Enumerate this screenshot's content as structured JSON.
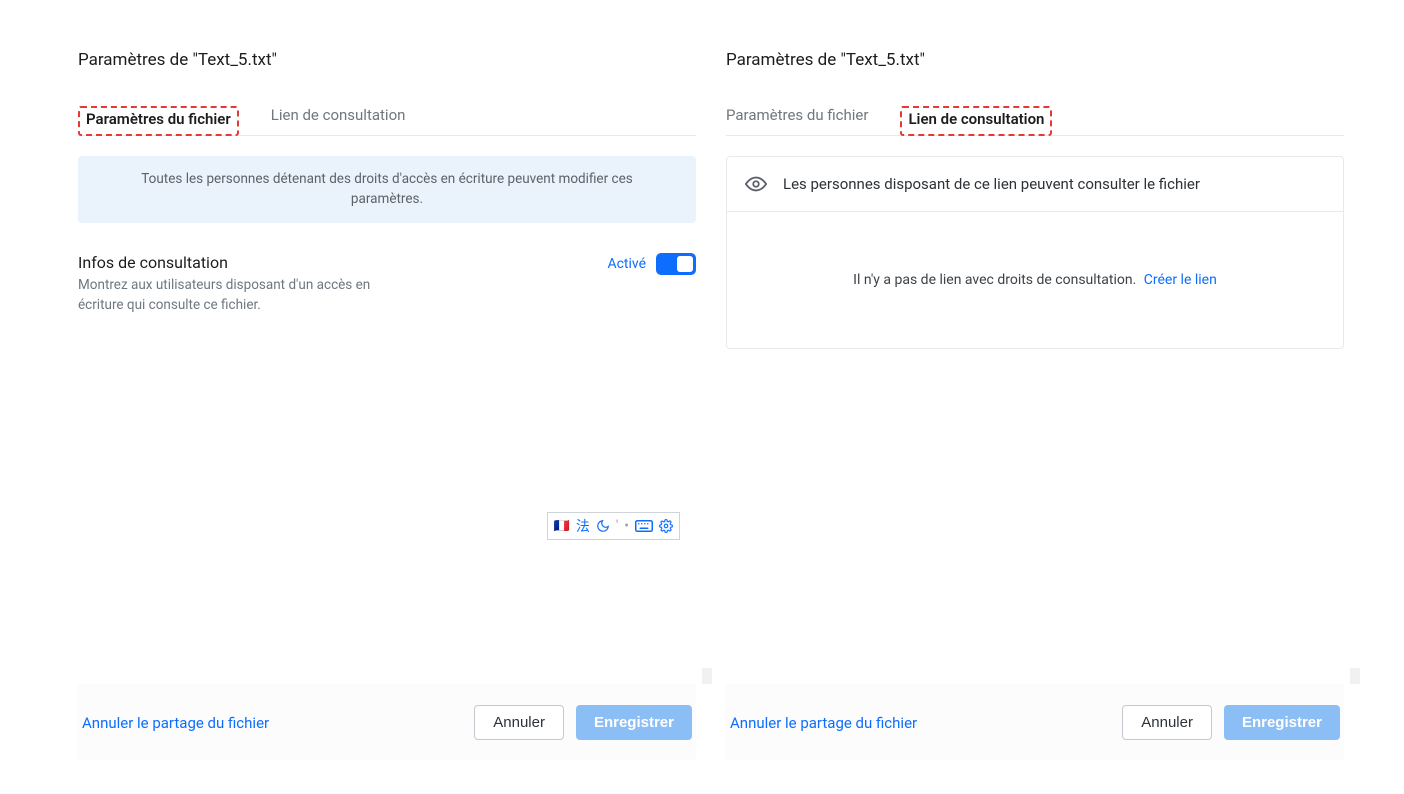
{
  "left": {
    "title": "Paramètres de \"Text_5.txt\"",
    "tabs": [
      {
        "label": "Paramètres du fichier"
      },
      {
        "label": "Lien de consultation"
      }
    ],
    "banner": "Toutes les personnes détenant des droits d'accès en écriture peuvent modifier ces paramètres.",
    "setting": {
      "title": "Infos de consultation",
      "desc": "Montrez aux utilisateurs disposant d'un accès en écriture qui consulte ce fichier.",
      "state_label": "Activé"
    },
    "footer": {
      "unshare": "Annuler le partage du fichier",
      "cancel": "Annuler",
      "save": "Enregistrer"
    },
    "toolbar": {
      "flag": "🇫🇷",
      "cjk": "法",
      "moon": "moon-icon",
      "comma": "comma-icon",
      "keyboard": "keyboard-icon",
      "gear": "gear-icon"
    }
  },
  "right": {
    "title": "Paramètres de \"Text_5.txt\"",
    "tabs": [
      {
        "label": "Paramètres du fichier"
      },
      {
        "label": "Lien de consultation"
      }
    ],
    "visibility_text": "Les personnes disposant de ce lien peuvent consulter le fichier",
    "empty_text": "Il n'y a pas de lien avec droits de consultation.",
    "create_link": "Créer le lien",
    "footer": {
      "unshare": "Annuler le partage du fichier",
      "cancel": "Annuler",
      "save": "Enregistrer"
    }
  }
}
